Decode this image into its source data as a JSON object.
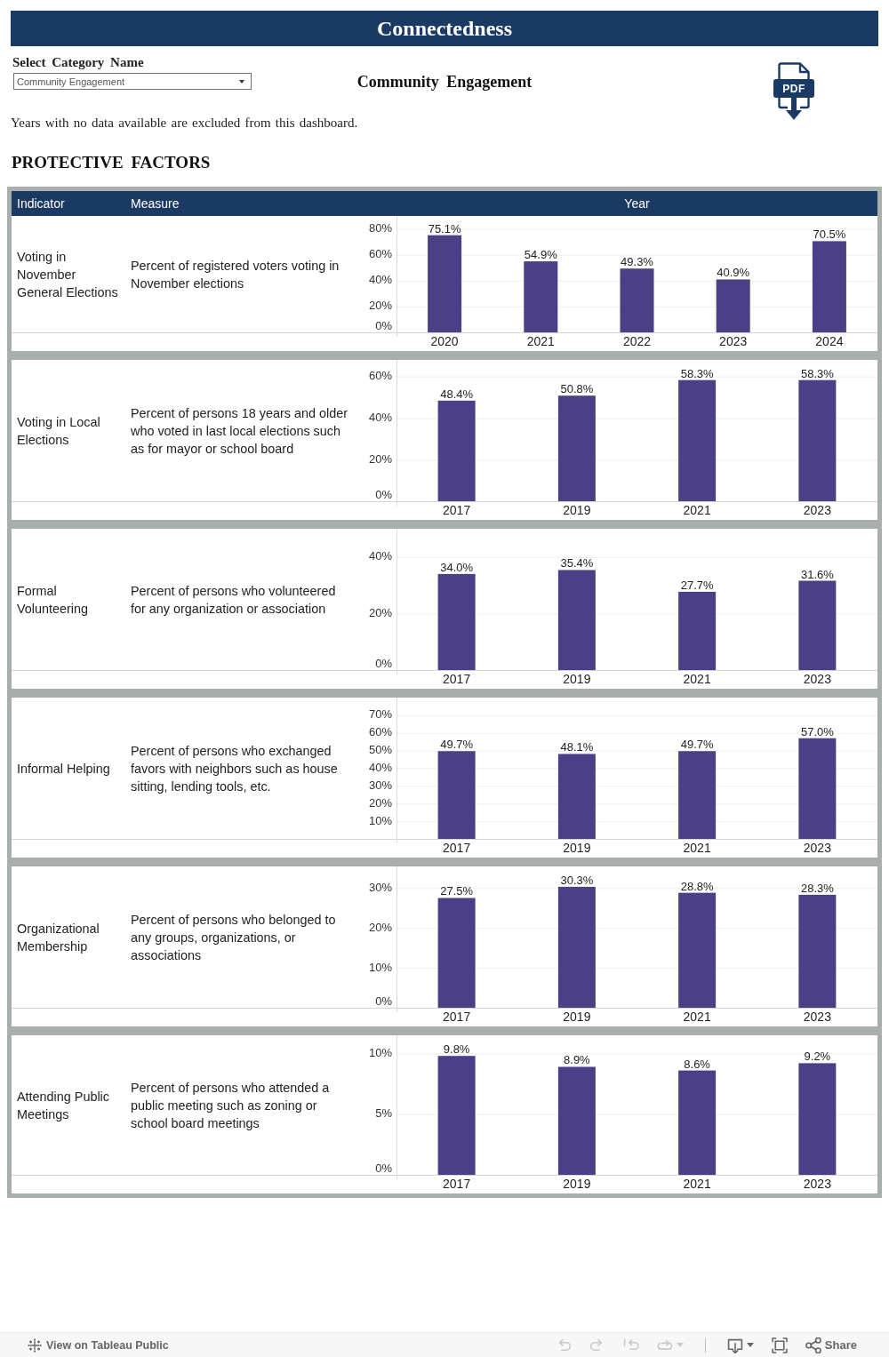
{
  "title": "Connectedness",
  "filter": {
    "label": "Select Category Name",
    "value": "Community Engagement"
  },
  "heading": "Community Engagement",
  "pdf_button": {
    "label": "PDF"
  },
  "note": "Years with no data available are excluded from this dashboard.",
  "section_title": "PROTECTIVE FACTORS",
  "table": {
    "columns": [
      "Indicator",
      "Measure",
      "Year"
    ],
    "rows": [
      {
        "indicator": "Voting in November General Elections",
        "measure": "Percent of registered voters voting in November elections",
        "chart_data": {
          "type": "bar",
          "categories": [
            "2020",
            "2021",
            "2022",
            "2023",
            "2024"
          ],
          "values": [
            75.1,
            54.9,
            49.3,
            40.9,
            70.5
          ],
          "value_labels": [
            "75.1%",
            "54.9%",
            "49.3%",
            "40.9%",
            "70.5%"
          ],
          "ylim": [
            0,
            90
          ],
          "yticks": [
            {
              "value": 0,
              "label": "0%"
            },
            {
              "value": 20,
              "label": "20%"
            },
            {
              "value": 40,
              "label": "40%"
            },
            {
              "value": 60,
              "label": "60%"
            },
            {
              "value": 80,
              "label": "80%"
            }
          ],
          "grid": true
        }
      },
      {
        "indicator": "Voting in Local Elections",
        "measure": "Percent of persons 18 years and older who voted in last local elections such as for mayor or school board",
        "chart_data": {
          "type": "bar",
          "categories": [
            "2017",
            "2019",
            "2021",
            "2023"
          ],
          "values": [
            48.4,
            50.8,
            58.3,
            58.3
          ],
          "value_labels": [
            "48.4%",
            "50.8%",
            "58.3%",
            "58.3%"
          ],
          "ylim": [
            0,
            68
          ],
          "yticks": [
            {
              "value": 0,
              "label": "0%"
            },
            {
              "value": 20,
              "label": "20%"
            },
            {
              "value": 40,
              "label": "40%"
            },
            {
              "value": 60,
              "label": "60%"
            }
          ],
          "grid": true
        }
      },
      {
        "indicator": "Formal Volunteering",
        "measure": "Percent of persons who volunteered for any organization or association",
        "chart_data": {
          "type": "bar",
          "categories": [
            "2017",
            "2019",
            "2021",
            "2023"
          ],
          "values": [
            34.0,
            35.4,
            27.7,
            31.6
          ],
          "value_labels": [
            "34.0%",
            "35.4%",
            "27.7%",
            "31.6%"
          ],
          "ylim": [
            0,
            50
          ],
          "yticks": [
            {
              "value": 0,
              "label": "0%"
            },
            {
              "value": 20,
              "label": "20%"
            },
            {
              "value": 40,
              "label": "40%"
            }
          ],
          "grid": true
        }
      },
      {
        "indicator": "Informal Helping",
        "measure": "Percent of persons who exchanged favors with neighbors such as house sitting, lending tools, etc.",
        "chart_data": {
          "type": "bar",
          "categories": [
            "2017",
            "2019",
            "2021",
            "2023"
          ],
          "values": [
            49.7,
            48.1,
            49.7,
            57.0
          ],
          "value_labels": [
            "49.7%",
            "48.1%",
            "49.7%",
            "57.0%"
          ],
          "ylim": [
            0,
            80
          ],
          "yticks": [
            {
              "value": 10,
              "label": "10%"
            },
            {
              "value": 20,
              "label": "20%"
            },
            {
              "value": 30,
              "label": "30%"
            },
            {
              "value": 40,
              "label": "40%"
            },
            {
              "value": 50,
              "label": "50%"
            },
            {
              "value": 60,
              "label": "60%"
            },
            {
              "value": 70,
              "label": "70%"
            }
          ],
          "grid": true
        }
      },
      {
        "indicator": "Organizational Membership",
        "measure": "Percent of persons who belonged to any groups, organizations, or associations",
        "chart_data": {
          "type": "bar",
          "categories": [
            "2017",
            "2019",
            "2021",
            "2023"
          ],
          "values": [
            27.5,
            30.3,
            28.8,
            28.3
          ],
          "value_labels": [
            "27.5%",
            "30.3%",
            "28.8%",
            "28.3%"
          ],
          "ylim": [
            0,
            35.4
          ],
          "yticks": [
            {
              "value": 0,
              "label": "0%"
            },
            {
              "value": 10,
              "label": "10%"
            },
            {
              "value": 20,
              "label": "20%"
            },
            {
              "value": 30,
              "label": "30%"
            }
          ],
          "grid": true
        }
      },
      {
        "indicator": "Attending Public Meetings",
        "measure": "Percent of persons who attended a public meeting such as zoning or school board meetings",
        "chart_data": {
          "type": "bar",
          "categories": [
            "2017",
            "2019",
            "2021",
            "2023"
          ],
          "values": [
            9.8,
            8.9,
            8.6,
            9.2
          ],
          "value_labels": [
            "9.8%",
            "8.9%",
            "8.6%",
            "9.2%"
          ],
          "ylim": [
            0,
            11.5
          ],
          "yticks": [
            {
              "value": 0,
              "label": "0%"
            },
            {
              "value": 5,
              "label": "5%"
            },
            {
              "value": 10,
              "label": "10%"
            }
          ],
          "grid": true
        }
      }
    ]
  },
  "toolbar": {
    "link": "View on Tableau Public",
    "history_buttons": [
      {
        "kind": "undo",
        "disabled": true,
        "menu": false
      },
      {
        "kind": "redo",
        "disabled": true,
        "menu": false
      },
      {
        "kind": "revert",
        "disabled": true,
        "menu": false
      },
      {
        "kind": "refresh",
        "disabled": true,
        "menu": true
      }
    ],
    "view_buttons": [
      {
        "kind": "download",
        "disabled": false,
        "menu": true
      },
      {
        "kind": "fullscreen",
        "disabled": false,
        "menu": false
      },
      {
        "kind": "share",
        "disabled": false,
        "menu": false,
        "label": "Share"
      }
    ]
  }
}
